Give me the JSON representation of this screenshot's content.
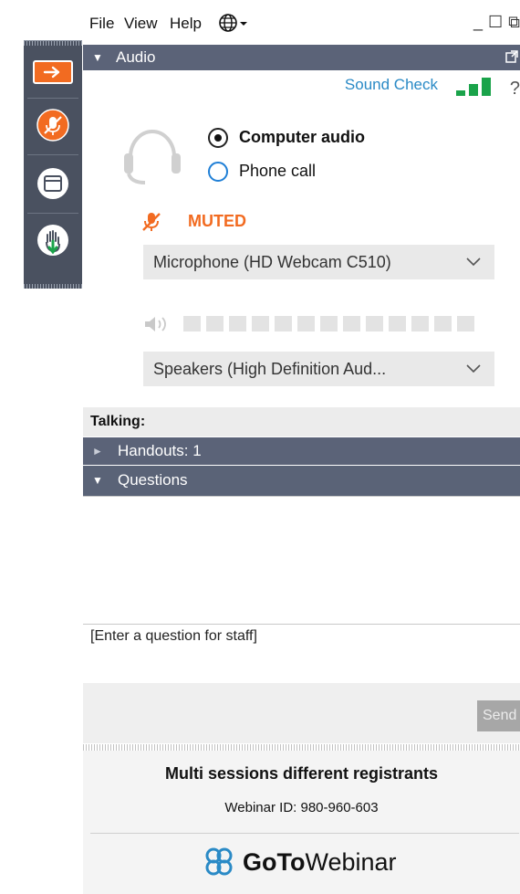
{
  "menu": {
    "file": "File",
    "view": "View",
    "help": "Help"
  },
  "window_controls": {
    "minimize": "_",
    "maximize": "☐",
    "restore": "⧉"
  },
  "audio_section": {
    "title": "Audio",
    "sound_check": "Sound Check",
    "help_label": "?",
    "options": [
      {
        "label": "Computer audio",
        "selected": true
      },
      {
        "label": "Phone call",
        "selected": false
      }
    ],
    "status": "MUTED",
    "microphone": "Microphone (HD Webcam C510)",
    "speakers": "Speakers (High Definition Aud..."
  },
  "talking_label": "Talking:",
  "handouts": {
    "label": "Handouts: 1"
  },
  "questions": {
    "label": "Questions",
    "input_placeholder": "[Enter a question for staff]",
    "send_label": "Send"
  },
  "session": {
    "title": "Multi sessions different registrants",
    "webinar_id": "Webinar ID: 980-960-603"
  },
  "brand": {
    "bold": "GoTo",
    "regular": "Webinar"
  },
  "colors": {
    "accent_orange": "#f26b21",
    "bar_slate": "#5b6378",
    "link_blue": "#2a8ac6",
    "signal_green": "#1aa34a"
  }
}
